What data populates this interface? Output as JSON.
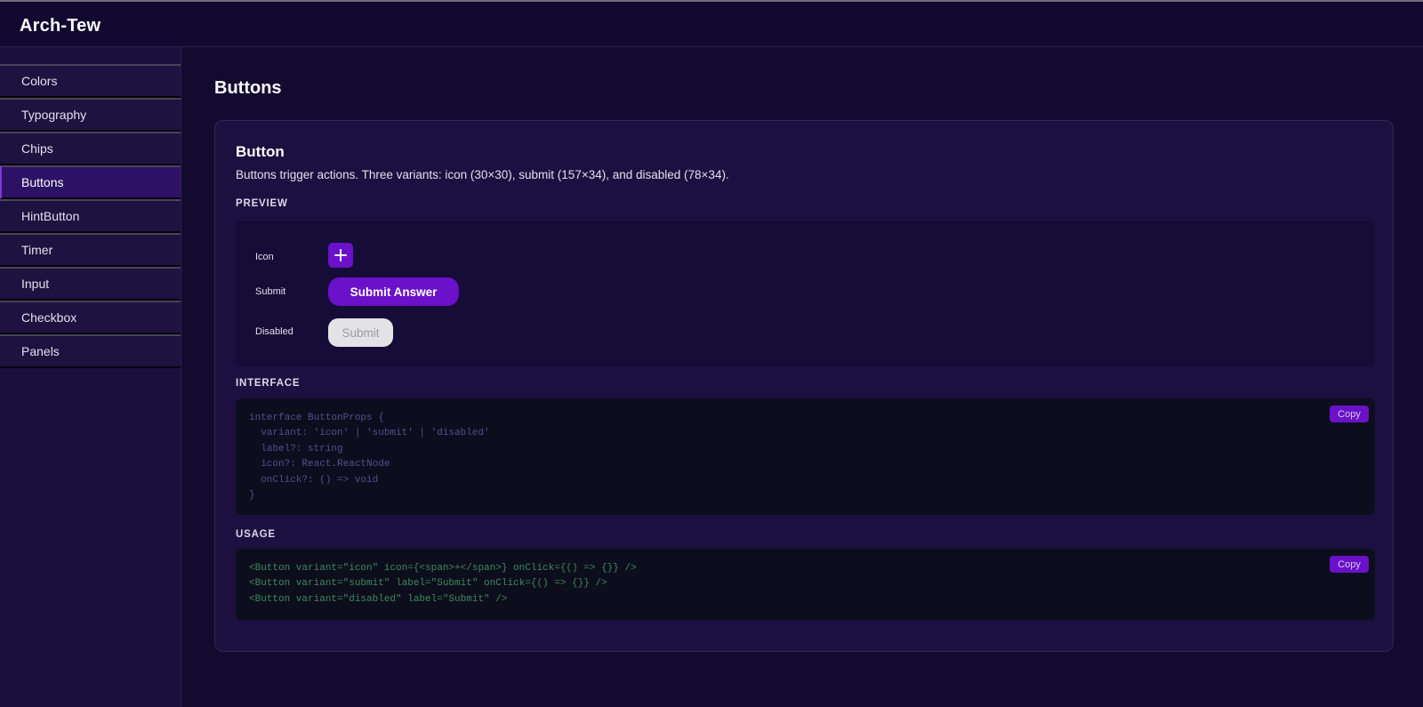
{
  "app": {
    "title": "Arch-Tew"
  },
  "sidebar": {
    "items": [
      {
        "label": "Colors"
      },
      {
        "label": "Typography"
      },
      {
        "label": "Chips"
      },
      {
        "label": "Buttons",
        "active": true
      },
      {
        "label": "HintButton"
      },
      {
        "label": "Timer"
      },
      {
        "label": "Input"
      },
      {
        "label": "Checkbox"
      },
      {
        "label": "Panels"
      }
    ]
  },
  "page": {
    "title": "Buttons"
  },
  "component": {
    "title": "Button",
    "description": "Buttons trigger actions. Three variants: icon (30×30), submit (157×34), and disabled (78×34)."
  },
  "preview": {
    "section_label": "PREVIEW",
    "rows": {
      "icon": {
        "label": "Icon",
        "icon": "plus-icon"
      },
      "submit": {
        "label": "Submit",
        "button_label": "Submit Answer"
      },
      "disabled": {
        "label": "Disabled",
        "button_label": "Submit"
      }
    }
  },
  "interface": {
    "section_label": "INTERFACE",
    "copy_label": "Copy",
    "code": "interface ButtonProps {\n  variant: 'icon' | 'submit' | 'disabled'\n  label?: string\n  icon?: React.ReactNode\n  onClick?: () => void\n}"
  },
  "usage": {
    "section_label": "USAGE",
    "copy_label": "Copy",
    "code": "<Button variant=\"icon\" icon={<span>+</span>} onClick={() => {}} />\n<Button variant=\"submit\" label=\"Submit\" onClick={() => {}} />\n<Button variant=\"disabled\" label=\"Submit\" />"
  },
  "colors": {
    "background": "#130a30",
    "accent": "#6a11c9",
    "code_background": "#0d0e1d",
    "interface_code_text": "#5b4a92",
    "usage_code_text": "#3e8a5a"
  }
}
